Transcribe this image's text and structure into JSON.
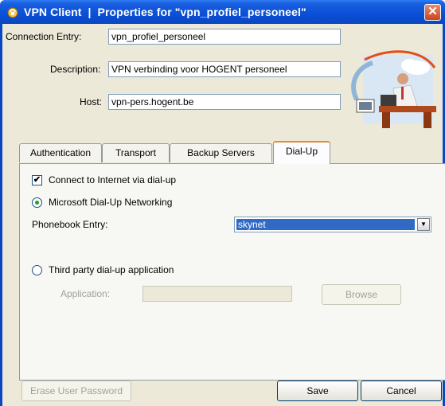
{
  "window": {
    "title": "VPN Client  |  Properties for \"vpn_profiel_personeel\"",
    "close_glyph": "✕"
  },
  "fields": {
    "connection_entry_label": "Connection Entry:",
    "connection_entry_value": "vpn_profiel_personeel",
    "description_label": "Description:",
    "description_value": "VPN verbinding voor HOGENT personeel",
    "host_label": "Host:",
    "host_value": "vpn-pers.hogent.be"
  },
  "tabs": [
    {
      "label": "Authentication"
    },
    {
      "label": "Transport"
    },
    {
      "label": "Backup Servers"
    },
    {
      "label": "Dial-Up"
    }
  ],
  "active_tab": "Dial-Up",
  "dialup": {
    "connect_checkbox_label": "Connect to Internet via dial-up",
    "connect_checked": true,
    "check_glyph": "✔",
    "ms_radio_label": "Microsoft Dial-Up Networking",
    "ms_selected": true,
    "phonebook_label": "Phonebook Entry:",
    "phonebook_value": "skynet",
    "third_party_label": "Third party dial-up application",
    "third_party_selected": false,
    "application_label": "Application:",
    "application_value": "",
    "browse_label": "Browse"
  },
  "footer": {
    "erase_label": "Erase User Password",
    "save_label": "Save",
    "cancel_label": "Cancel"
  },
  "colors": {
    "titlebar": "#0a4fd6",
    "window_bg": "#ece9d8",
    "selection": "#316ac5",
    "close_button": "#c9461f"
  }
}
